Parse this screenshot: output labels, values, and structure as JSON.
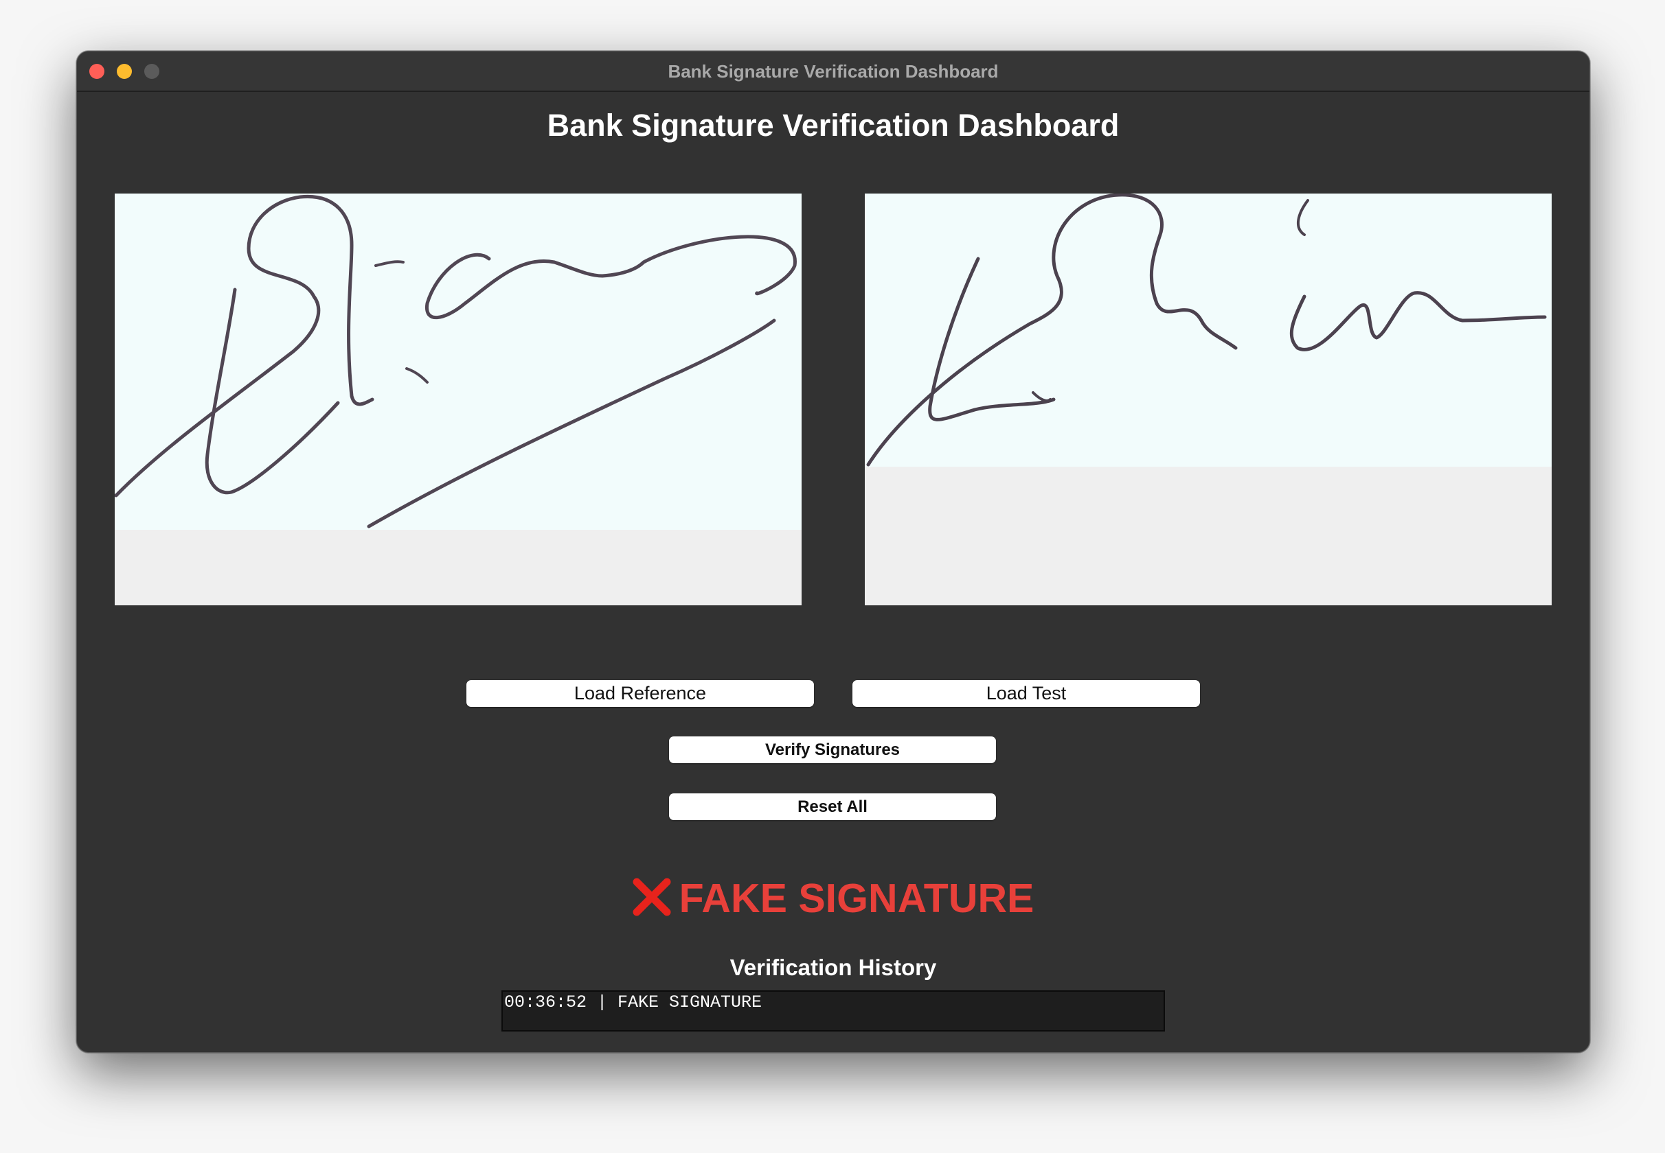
{
  "window": {
    "title": "Bank Signature Verification Dashboard"
  },
  "header": {
    "title": "Bank Signature Verification Dashboard"
  },
  "buttons": {
    "load_reference": "Load Reference",
    "load_test": "Load Test",
    "verify": "Verify Signatures",
    "reset": "Reset All"
  },
  "result": {
    "icon": "cross-mark-icon",
    "text": "FAKE SIGNATURE",
    "color": "#e8403a"
  },
  "history": {
    "title": "Verification History",
    "entries": [
      "00:36:52 | FAKE SIGNATURE"
    ]
  },
  "colors": {
    "window_bg": "#323232",
    "signature_paper": "#f2fcfc",
    "ink": "#3a2e3c",
    "history_bg": "#1e1e1e"
  }
}
